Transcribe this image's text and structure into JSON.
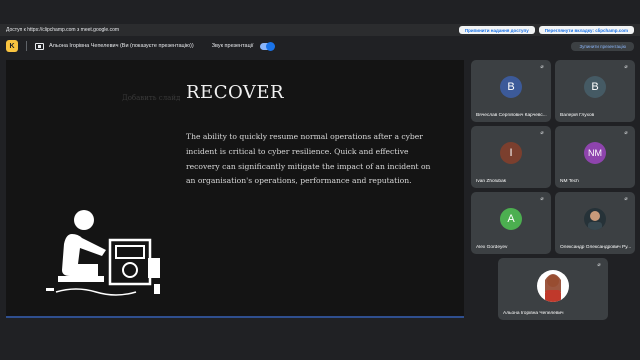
{
  "share_bar": {
    "text": "Доступ к https://clipchamp.com з meet.google.com",
    "stop_label": "Припинити надання доступу",
    "switch_label": "Переглянути вкладку: clipchamp.com"
  },
  "presentation_bar": {
    "logo_letter": "K",
    "title": "Альона Ігорівна Чепелевич (Ви (показуєте презентацію))",
    "sound_label": "Звук презентації",
    "sound_on": true,
    "stop_label": "Зупинити презентацію"
  },
  "slide": {
    "title": "RECOVER",
    "ghost_text": "Добавить слайд",
    "body": "The ability to quickly resume normal operations after a cyber incident is critical to cyber resilience. Quick and effective recovery can significantly mitigate the impact of an incident on an organisation's operations, performance and reputation."
  },
  "participants": [
    {
      "name": "Вячеслав Сергійович Карчевс...",
      "initial": "B",
      "color": "#3c5a99"
    },
    {
      "name": "Валерій Глухов",
      "initial": "B",
      "color": "#455a64"
    },
    {
      "name": "Ivan Zholubak",
      "initial": "I",
      "color": "#7b3f2e"
    },
    {
      "name": "NM Tech",
      "initial": "NM",
      "color": "#8e44ad"
    },
    {
      "name": "Alex Gordeyev",
      "initial": "A",
      "color": "#4caf50"
    },
    {
      "name": "Олександр Олександрович Ру...",
      "initial": "",
      "color": "#263238",
      "photo": true
    },
    {
      "name": "Альона Ігорівна Чепелевич",
      "initial": "",
      "color": "#ffffff",
      "photo": true
    }
  ],
  "icons": {
    "mic": "mic-off-icon",
    "present": "present-screen-icon",
    "logo": "clipchamp-logo"
  }
}
